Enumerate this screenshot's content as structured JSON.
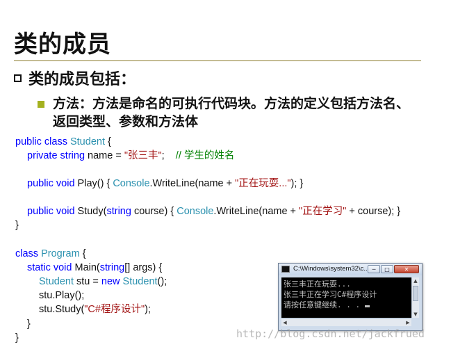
{
  "slide": {
    "title": "类的成员",
    "bullet1": "类的成员包括：",
    "bullet2": "方法：方法是命名的可执行代码块。方法的定义包括方法名、返回类型、参数和方法体"
  },
  "code": {
    "l1": {
      "kw": "public class ",
      "ty": "Student",
      "rest": " {"
    },
    "l2": {
      "kw": "private string ",
      "name": "name = ",
      "str": "\"张三丰\"",
      "semi": ";    ",
      "cm": "// 学生的姓名"
    },
    "l3": {
      "kw": "public void ",
      "pre": "Play() { ",
      "ty": "Console",
      "mid": ".WriteLine(name + ",
      "str": "\"正在玩耍...\"",
      "end": "); }"
    },
    "l4": {
      "kw": "public void ",
      "pre": "Study(",
      "kw2": "string",
      "pre2": " course) { ",
      "ty": "Console",
      "mid": ".WriteLine(name + ",
      "str": "\"正在学习\"",
      "end": " + course); }"
    },
    "l5": "}",
    "l6": {
      "kw": "class ",
      "ty": "Program",
      "rest": " {"
    },
    "l7": {
      "kw": "static void ",
      "pre": "Main(",
      "kw2": "string",
      "rest": "[] args) {"
    },
    "l8": {
      "ty": "Student",
      "pre": " stu = ",
      "kw": "new ",
      "ty2": "Student",
      "rest": "();"
    },
    "l9": "stu.Play();",
    "l10": {
      "pre": "stu.Study(",
      "str": "\"C#程序设计\"",
      "rest": ");"
    },
    "l11": "}",
    "l12": "}"
  },
  "console": {
    "title": "C:\\Windows\\system32\\c...",
    "lines": [
      "张三丰正在玩耍...",
      "张三丰正在学习C#程序设计",
      "请按任意键继续. . . "
    ],
    "min": "─",
    "max": "□",
    "close": "✕"
  },
  "watermark": "http://blog.csdn.net/jackfrued"
}
